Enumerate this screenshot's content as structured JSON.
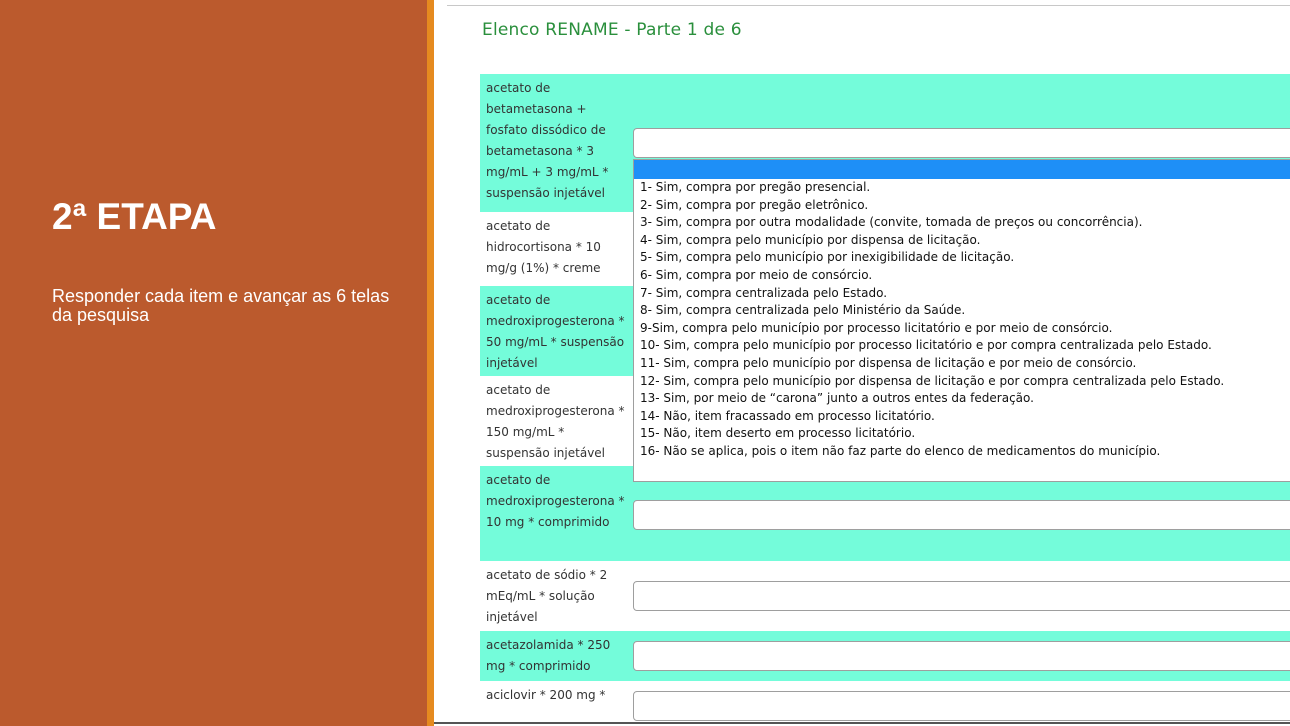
{
  "slide": {
    "title": "2ª ETAPA",
    "subtitle": "Responder cada item e avançar as 6 telas da pesquisa"
  },
  "form": {
    "title": "Elenco RENAME - Parte 1 de 6",
    "rows": [
      {
        "label": "acetato de betametasona + fosfato dissódico de betametasona * 3 mg/mL + 3 mg/mL * suspensão injetável",
        "value": ""
      },
      {
        "label": "acetato de hidrocortisona * 10 mg/g (1%) * creme",
        "value": ""
      },
      {
        "label": "acetato de medroxiprogesterona * 50 mg/mL * suspensão injetável",
        "value": ""
      },
      {
        "label": "acetato de medroxiprogesterona * 150 mg/mL * suspensão injetável",
        "value": ""
      },
      {
        "label": "acetato de medroxiprogesterona * 10 mg * comprimido",
        "value": ""
      },
      {
        "label": "acetato de sódio * 2 mEq/mL * solução injetável",
        "value": ""
      },
      {
        "label": "acetazolamida * 250 mg * comprimido",
        "value": ""
      },
      {
        "label": "aciclovir * 200 mg *",
        "value": ""
      }
    ]
  },
  "dropdown": {
    "selected": "",
    "options": [
      "1- Sim, compra por pregão presencial.",
      "2- Sim, compra por pregão eletrônico.",
      "3- Sim, compra por outra modalidade (convite, tomada de preços ou concorrência).",
      "4- Sim, compra pelo município por dispensa de licitação.",
      "5- Sim, compra pelo município por inexigibilidade de licitação.",
      "6- Sim, compra por meio de consórcio.",
      "7- Sim, compra centralizada pelo Estado.",
      "8- Sim, compra centralizada pelo Ministério da Saúde.",
      "9-Sim, compra pelo município por processo licitatório e por meio de consórcio.",
      "10- Sim, compra pelo município por processo licitatório e por compra centralizada pelo Estado.",
      "11- Sim, compra pelo município por dispensa de licitação e por meio de consórcio.",
      "12- Sim, compra pelo município por dispensa de licitação e por compra centralizada pelo Estado.",
      "13- Sim, por meio de “carona” junto a outros entes da federação.",
      "14- Não, item fracassado em processo licitatório.",
      "15- Não, item deserto em processo licitatório.",
      "16- Não se aplica, pois o item não faz parte do elenco de medicamentos do município."
    ]
  },
  "colors": {
    "left_panel": "#bb5a2d",
    "accent_stripe": "#e58a1f",
    "row_highlight": "#74fcda",
    "title_green": "#2a8f3c",
    "selection_blue": "#1e8ff7"
  }
}
